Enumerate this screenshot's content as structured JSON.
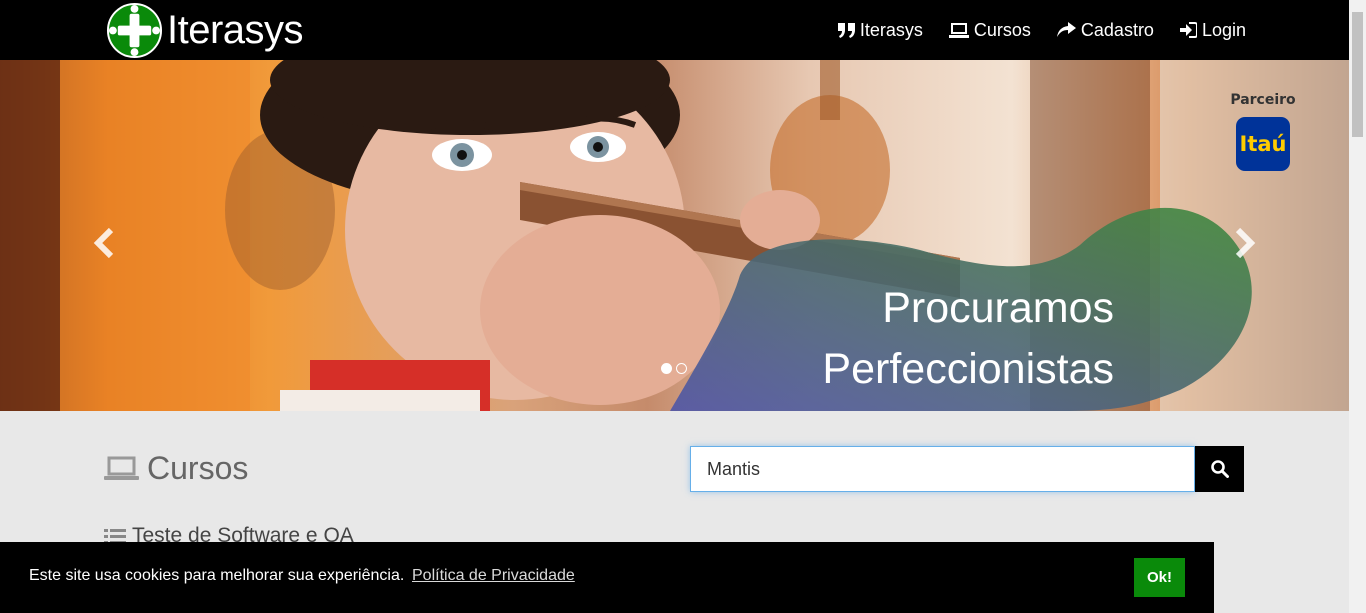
{
  "brand": {
    "name": "Iterasys",
    "logo_icon": "green-circle-plus-logo"
  },
  "nav": {
    "items": [
      {
        "label": "Iterasys",
        "icon": "quote-icon"
      },
      {
        "label": "Cursos",
        "icon": "laptop-icon"
      },
      {
        "label": "Cadastro",
        "icon": "share-arrow-icon"
      },
      {
        "label": "Login",
        "icon": "sign-in-icon"
      }
    ]
  },
  "carousel": {
    "headline_line1": "Procuramos",
    "headline_line2": "Perfeccionistas",
    "partner_label": "Parceiro",
    "partner_logo_text": "Itaú",
    "slide_count": 2,
    "active_slide": 1,
    "prev_icon": "chevron-left-icon",
    "next_icon": "chevron-right-icon"
  },
  "courses": {
    "title": "Cursos",
    "title_icon": "laptop-icon",
    "search_value": "Mantis",
    "search_icon": "search-icon",
    "category": "Teste de Software e QA",
    "category_icon": "list-icon"
  },
  "cookie": {
    "message": "Este site usa cookies para melhorar sua experiência.",
    "link_label": "Política de Privacidade",
    "ok_label": "Ok!"
  },
  "colors": {
    "navbar_bg": "#000000",
    "brand_green": "#0a8a0a",
    "itau_blue": "#003399",
    "itau_yellow": "#ffcc00"
  }
}
